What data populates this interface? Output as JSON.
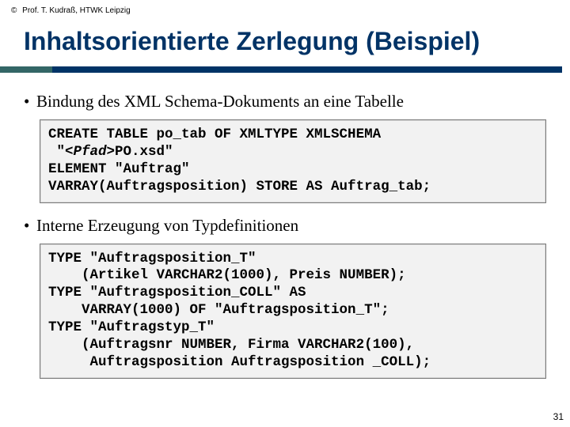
{
  "copyright": {
    "symbol": "©",
    "text": "Prof. T. Kudraß, HTWK Leipzig"
  },
  "title": "Inhaltsorientierte Zerlegung (Beispiel)",
  "bullets": [
    {
      "text": "Bindung des XML Schema-Dokuments an eine Tabelle"
    },
    {
      "text": "Interne Erzeugung von Typdefinitionen"
    }
  ],
  "code1": {
    "l1a": "CREATE TABLE po_tab OF XMLTYPE XMLSCHEMA",
    "l2a": " \"",
    "l2ph": "<Pfad>",
    "l2b": "PO.xsd\"",
    "l3": "ELEMENT \"Auftrag\"",
    "l4": "VARRAY(Auftragsposition) STORE AS Auftrag_tab;"
  },
  "code2": {
    "l1": "TYPE \"Auftragsposition_T\"",
    "l2": "    (Artikel VARCHAR2(1000), Preis NUMBER);",
    "l3": "TYPE \"Auftragsposition_COLL\" AS",
    "l4": "    VARRAY(1000) OF \"Auftragsposition_T\";",
    "l5": "TYPE \"Auftragstyp_T\"",
    "l6": "    (Auftragsnr NUMBER, Firma VARCHAR2(100),",
    "l7": "     Auftragsposition Auftragsposition _COLL);"
  },
  "page_number": "31"
}
